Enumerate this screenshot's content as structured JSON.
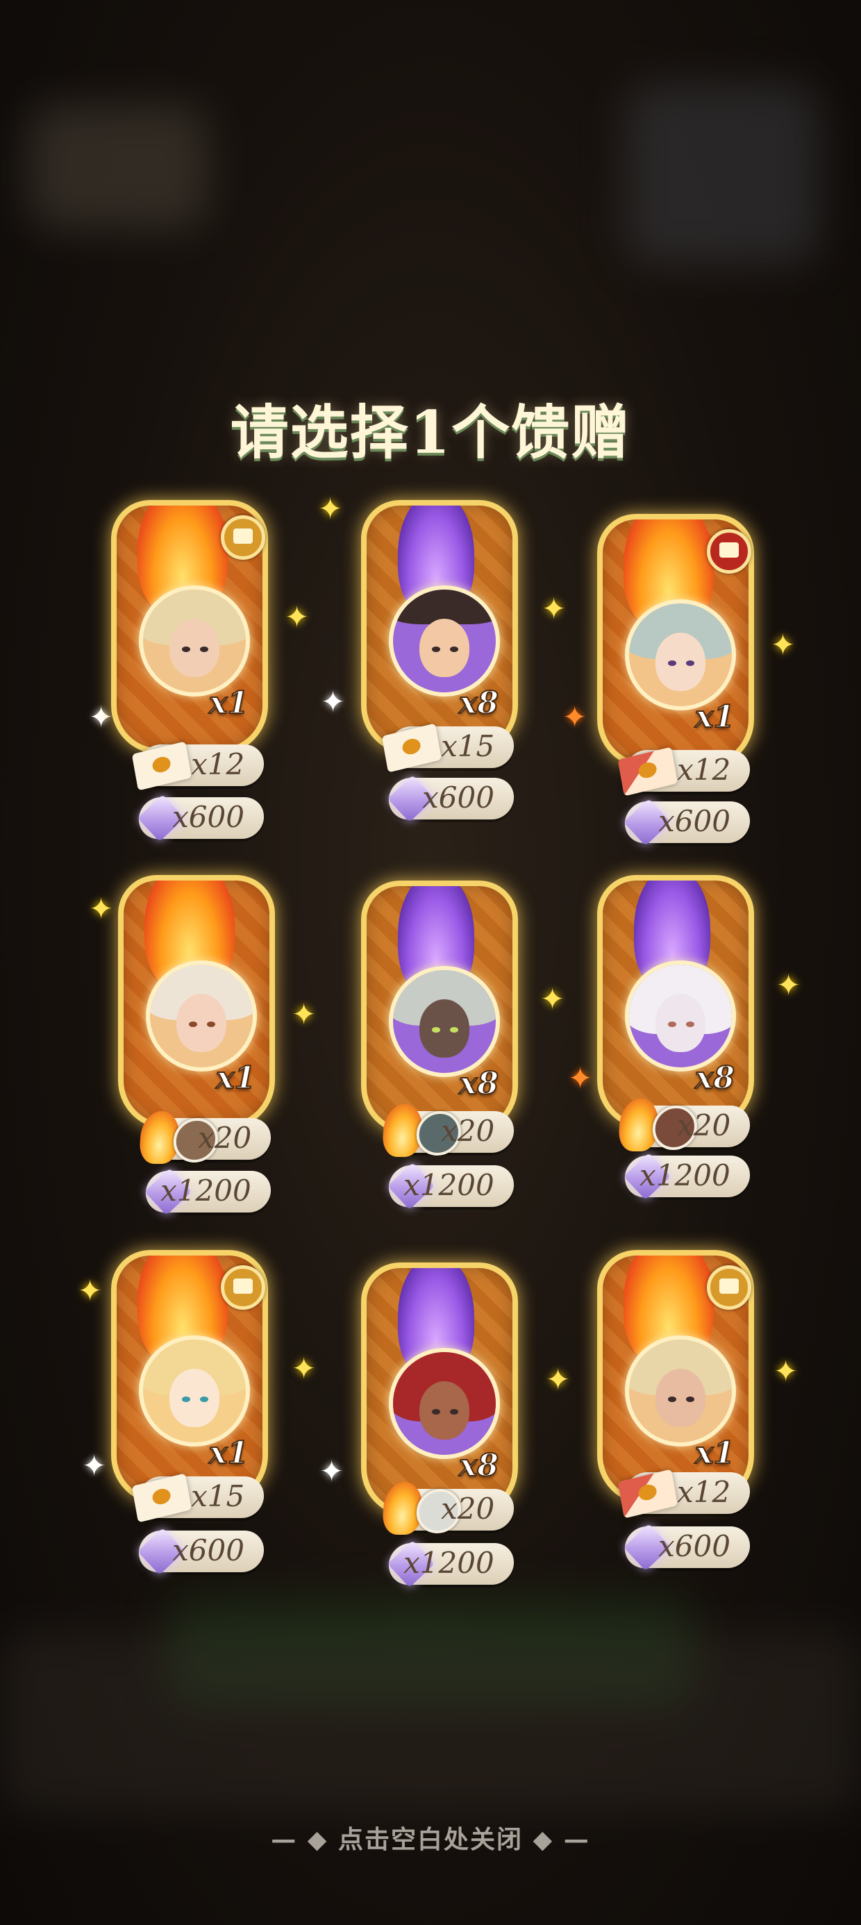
{
  "title": "请选择1个馈赠",
  "footer": "点击空白处关闭",
  "colors": {
    "title": "#fff6d8",
    "accent_gold": "#f6d46a",
    "orange_card": "#c8641b",
    "purple_wisp": "#9a5ae6",
    "footer": "#a8a29a"
  },
  "gifts": [
    {
      "card_style": "orange-flame",
      "portrait": "blonde-hair-hero",
      "quantity": "x1",
      "badge": "gold-badge-icon",
      "rewards": [
        {
          "icon": "envelope-icon",
          "amount": "x12"
        },
        {
          "icon": "diamond-icon",
          "amount": "x600"
        }
      ]
    },
    {
      "card_style": "purple-wisp",
      "portrait": "bearded-pirate-hero",
      "quantity": "x8",
      "rewards": [
        {
          "icon": "envelope-icon",
          "amount": "x15"
        },
        {
          "icon": "diamond-icon",
          "amount": "x600"
        }
      ]
    },
    {
      "card_style": "orange-flame",
      "portrait": "silver-hair-girl-hero",
      "quantity": "x1",
      "badge": "red-badge-icon",
      "rewards": [
        {
          "icon": "red-envelope-icon",
          "amount": "x12"
        },
        {
          "icon": "diamond-icon",
          "amount": "x600"
        }
      ]
    },
    {
      "card_style": "orange-flame",
      "portrait": "white-hair-boy-hero",
      "quantity": "x1",
      "rewards": [
        {
          "icon": "flame-shard-icon",
          "amount": "x20"
        },
        {
          "icon": "diamond-icon",
          "amount": "x1200"
        }
      ]
    },
    {
      "card_style": "purple-wisp",
      "portrait": "silver-hair-dark-skin-hero",
      "quantity": "x8",
      "rewards": [
        {
          "icon": "flame-shard-icon",
          "amount": "x20"
        },
        {
          "icon": "diamond-icon",
          "amount": "x1200"
        }
      ]
    },
    {
      "card_style": "purple-wisp",
      "portrait": "white-beast-hero",
      "quantity": "x8",
      "rewards": [
        {
          "icon": "flame-shard-icon",
          "amount": "x20"
        },
        {
          "icon": "diamond-icon",
          "amount": "x1200"
        }
      ]
    },
    {
      "card_style": "orange-flame",
      "portrait": "golden-curls-girl-hero",
      "quantity": "x1",
      "badge": "gold-badge-icon",
      "rewards": [
        {
          "icon": "envelope-icon",
          "amount": "x15"
        },
        {
          "icon": "diamond-icon",
          "amount": "x600"
        }
      ]
    },
    {
      "card_style": "purple-wisp",
      "portrait": "red-hair-girl-hero",
      "quantity": "x8",
      "rewards": [
        {
          "icon": "flame-shard-icon",
          "amount": "x20"
        },
        {
          "icon": "diamond-icon",
          "amount": "x1200"
        }
      ]
    },
    {
      "card_style": "orange-flame",
      "portrait": "blonde-hair-hero",
      "quantity": "x1",
      "badge": "gold-badge-icon",
      "rewards": [
        {
          "icon": "red-envelope-icon",
          "amount": "x12"
        },
        {
          "icon": "diamond-icon",
          "amount": "x600"
        }
      ]
    }
  ]
}
